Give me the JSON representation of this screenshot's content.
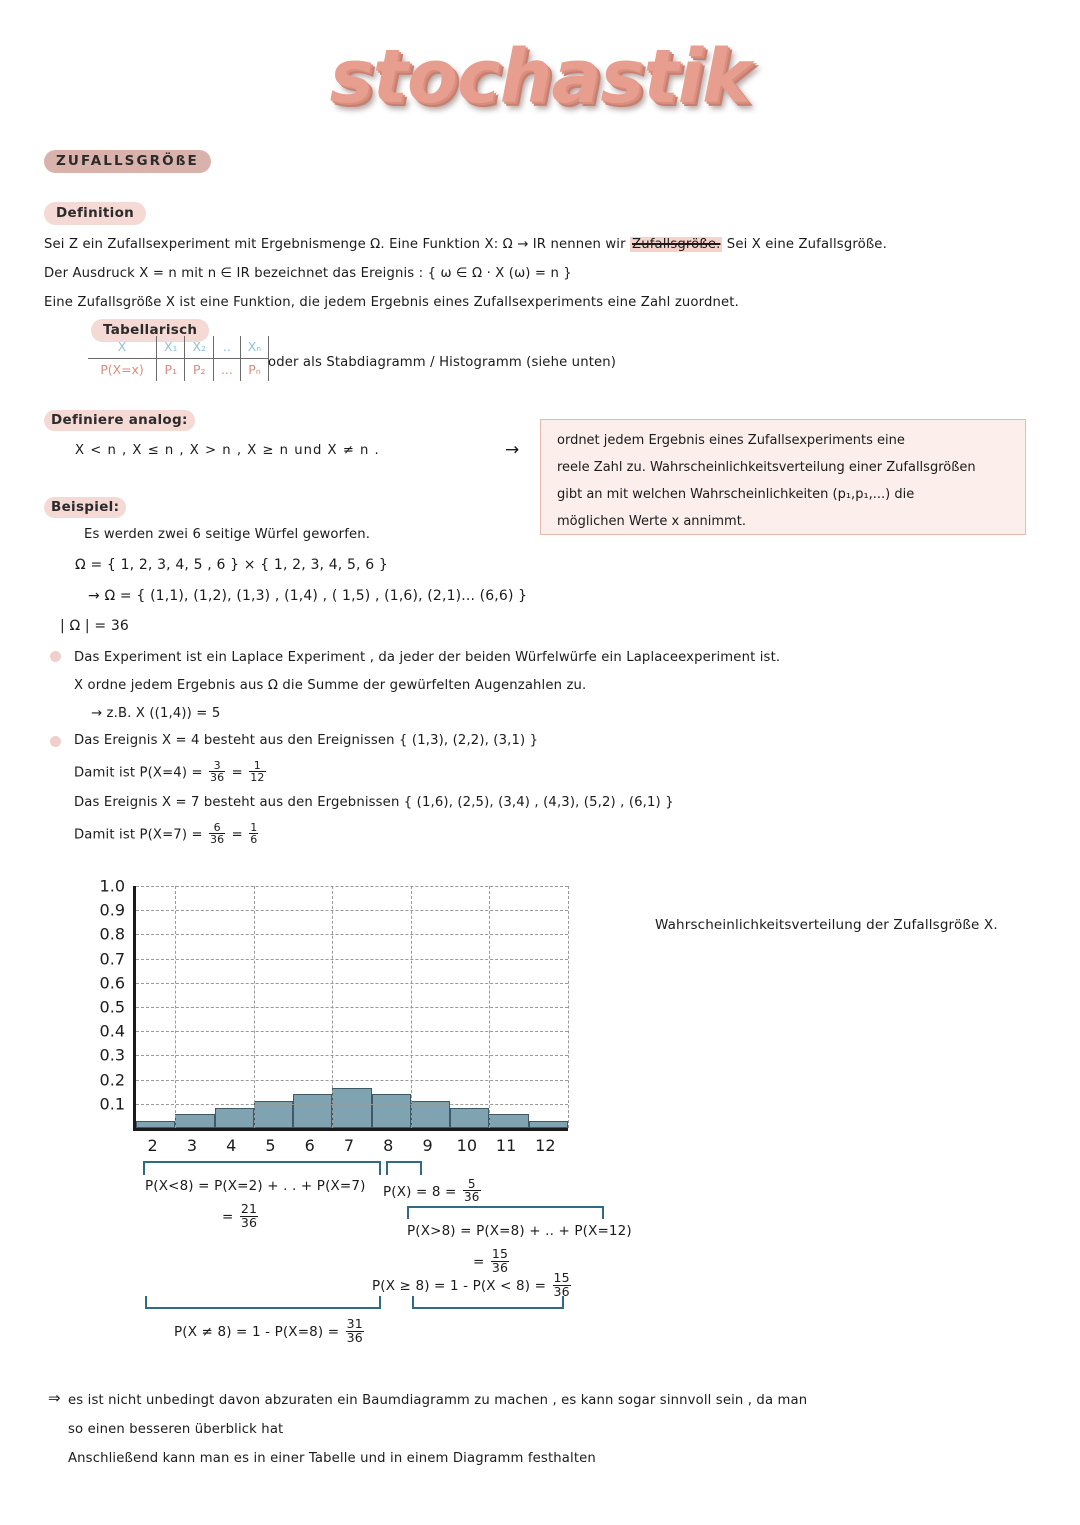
{
  "title": "stochastik",
  "topic_badge": "ZUFALLSGRÖßE",
  "definition": {
    "badge": "Definition",
    "line1_a": "Sei Z ein Zufallsexperiment mit Ergebnismenge  Ω. Eine Funktion  X:  Ω → IR  nennen wir ",
    "line1_hl": "Zufallsgröße.",
    "line1_b": " Sei X eine  Zufallsgröße.",
    "line2": "Der Ausdruck  X = n  mit  n ∈ IR  bezeichnet das Ereignis : { ω ∈ Ω · X (ω) = n }",
    "line3": "Eine Zufallsgröße X ist eine  Funktion, die jedem Ergebnis  eines Zufallsexperiments eine  Zahl zuordnet."
  },
  "tabellarisch": {
    "badge": "Tabellarisch",
    "row_head": [
      "X",
      "X₁",
      "X₂",
      "..",
      "Xₙ"
    ],
    "row_prob": [
      "P(X=x)",
      "P₁",
      "P₂",
      "...",
      "Pₙ"
    ],
    "note": "oder als Stabdiagramm / Histogramm  (siehe unten)"
  },
  "analog": {
    "badge": "Definiere analog:",
    "line": "X < n ,  X ≤ n , X > n , X ≥ n   und  X ≠ n .",
    "arrow": "→"
  },
  "infobox": {
    "line1": "ordnet jedem Ergebnis eines  Zufallsexperiments eine",
    "line2": "reele Zahl zu. Wahrscheinlichkeitsverteilung einer Zufallsgrößen",
    "line3": "gibt an mit welchen  Wahrscheinlichkeiten (p₁,p₁,...) die",
    "line4": "möglichen Werte  x  annimmt."
  },
  "beispiel": {
    "badge": "Beispiel:",
    "line1": "Es werden zwei 6 seitige Würfel geworfen.",
    "line2": "Ω = { 1, 2, 3, 4, 5 , 6 }  ×  { 1, 2, 3, 4, 5, 6 }",
    "line3": "→ Ω = { (1,1), (1,2),  (1,3) , (1,4) , ( 1,5) , (1,6), (2,1)...  (6,6) }",
    "line4": "| Ω | = 36",
    "b1": "Das Experiment ist ein Laplace Experiment , da jeder der beiden Würfelwürfe ein Laplaceexperiment ist.",
    "b1b": "X ordne jedem Ergebnis aus  Ω  die Summe der gewürfelten Augenzahlen zu.",
    "b1c": "→  z.B. X ((1,4)) = 5",
    "b2": "Das Ereignis X = 4 besteht aus den Ereignissen  { (1,3), (2,2), (3,1) }",
    "b2b_pre": "Damit ist  P(X=4) = ",
    "b2b_f1_num": "3",
    "b2b_f1_den": "36",
    "b2b_mid": " = ",
    "b2b_f2_num": "1",
    "b2b_f2_den": "12",
    "b3": "Das Ereignis X = 7 besteht aus den Ergebnissen  { (1,6), (2,5), (3,4) , (4,3), (5,2) , (6,1) }",
    "b3b_pre": "Damit ist  P(X=7) = ",
    "b3b_f1_num": "6",
    "b3b_f1_den": "36",
    "b3b_mid": " = ",
    "b3b_f2_num": "1",
    "b3b_f2_den": "6"
  },
  "chart_caption": "Wahrscheinlichkeitsverteilung der Zufallsgröße X.",
  "chart_data": {
    "type": "bar",
    "title": "",
    "categories": [
      "2",
      "3",
      "4",
      "5",
      "6",
      "7",
      "8",
      "9",
      "10",
      "11",
      "12"
    ],
    "values": [
      0.028,
      0.056,
      0.083,
      0.111,
      0.139,
      0.167,
      0.139,
      0.111,
      0.083,
      0.056,
      0.028
    ],
    "value_fractions": [
      "1/36",
      "2/36",
      "3/36",
      "4/36",
      "5/36",
      "6/36",
      "5/36",
      "4/36",
      "3/36",
      "2/36",
      "1/36"
    ],
    "xlabel": "",
    "ylabel": "",
    "ylim": [
      0,
      1.0
    ],
    "ytick_labels": [
      "1.0",
      "0.9",
      "0.8",
      "0.7",
      "0.6",
      "0.5",
      "0.4",
      "0.3",
      "0.2",
      "0.1"
    ],
    "ytick_values": [
      1.0,
      0.9,
      0.8,
      0.7,
      0.6,
      0.5,
      0.4,
      0.3,
      0.2,
      0.1
    ],
    "grid": true,
    "bar_color": "#7fa3b0",
    "bar_edge_color": "#3f5a64",
    "legend": "none"
  },
  "annotations": {
    "a1_pre": "P(X<8) = P(X=2) + . . + P(X=7)",
    "a1_eq": "= ",
    "a1_num": "21",
    "a1_den": "36",
    "a2_pre": "P(X) = 8 = ",
    "a2_num": "5",
    "a2_den": "36",
    "a3_pre": "P(X>8) = P(X=8) + .. + P(X=12)",
    "a3_eq": "= ",
    "a3_num": "15",
    "a3_den": "36",
    "a4_pre": "P(X ≥ 8) =  1 - P(X < 8) = ",
    "a4_num": "15",
    "a4_den": "36",
    "a5_pre": "P(X ≠ 8) = 1 - P(X=8) =  ",
    "a5_num": "31",
    "a5_den": "36"
  },
  "footer": {
    "arrow": "⇒",
    "line1": "es ist nicht unbedingt davon abzuraten ein Baumdiagramm zu machen , es kann sogar  sinnvoll sein , da man",
    "line2": "so einen  besseren  überblick hat",
    "line3": "Anschließend kann man es in einer Tabelle  und in einem Diagramm  festhalten"
  },
  "colors": {
    "accent_pink": "#e79e8f",
    "badge_dark": "#d8b2ab",
    "badge_light": "#f4d9d4",
    "infobox_bg": "#fbeeeb",
    "infobox_border": "#e8b9b0",
    "bar": "#7fa3b0",
    "bracket": "#2f6a86",
    "table_head": "#8fc2d6",
    "table_prob": "#e08a7d"
  }
}
